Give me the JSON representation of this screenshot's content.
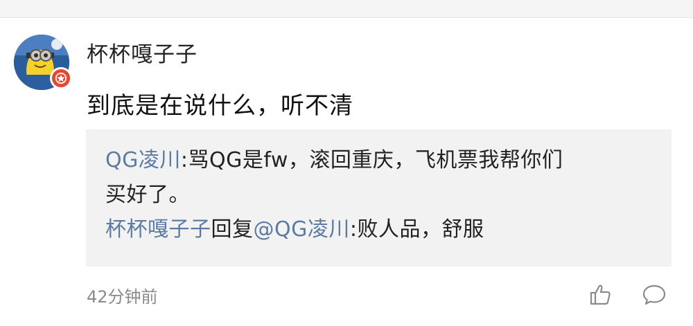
{
  "comment": {
    "username": "杯杯嘎子子",
    "text": "到底是在说什么，听不清",
    "avatar_icon": "minion-avatar-icon",
    "badge_icon": "verified-star-badge-icon",
    "badge_color": "#e8452c"
  },
  "quote": {
    "line1_user": "QG凌川",
    "line1_text": ":骂QG是fw，滚回重庆，飞机票我帮你们",
    "line2_text": "买好了。",
    "reply_user": "杯杯嘎子子",
    "reply_word": "回复",
    "reply_target": "@QG凌川",
    "reply_text": ":败人品，舒服"
  },
  "footer": {
    "timestamp": "42分钟前",
    "like_icon": "thumbs-up-icon",
    "reply_icon": "comment-bubble-icon"
  },
  "colors": {
    "link": "#5b7ba3",
    "quote_bg": "#f2f2f2",
    "timestamp": "#8a8a8a"
  }
}
